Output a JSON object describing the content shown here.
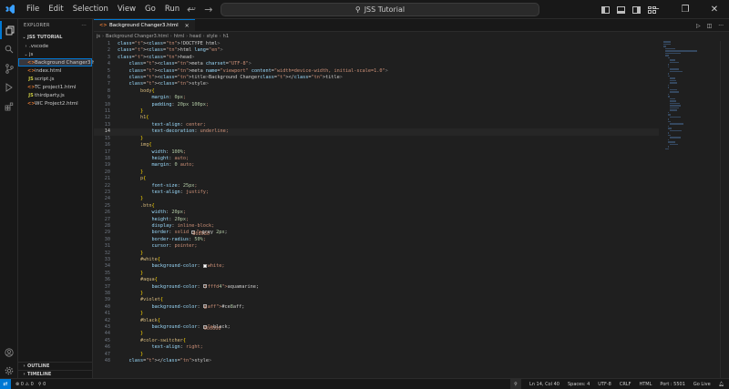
{
  "titlebar": {
    "menu": [
      "File",
      "Edit",
      "Selection",
      "View",
      "Go",
      "Run",
      "···"
    ],
    "search": "JSS Tutorial",
    "window_buttons": [
      "─",
      "❐",
      "✕"
    ]
  },
  "sidebar": {
    "title": "EXPLORER",
    "more": "···",
    "root": "JSS TUTORIAL",
    "items": [
      {
        "label": ".vscode",
        "type": "folder",
        "indent": 1,
        "expanded": false
      },
      {
        "label": "js",
        "type": "folder",
        "indent": 1,
        "expanded": true
      },
      {
        "label": "Background Changer3.html",
        "type": "html",
        "indent": 2,
        "selected": true
      },
      {
        "label": "index.html",
        "type": "html",
        "indent": 2
      },
      {
        "label": "script.js",
        "type": "js",
        "indent": 2
      },
      {
        "label": "TC project1.html",
        "type": "html",
        "indent": 2
      },
      {
        "label": "thirdparty.js",
        "type": "js",
        "indent": 2
      },
      {
        "label": "WC Project2.html",
        "type": "html",
        "indent": 2
      }
    ],
    "outline": "OUTLINE",
    "timeline": "TIMELINE"
  },
  "editor": {
    "tab": "Background Changer3.html",
    "breadcrumb": [
      "js",
      "Background Changer3.html",
      "html",
      "head",
      "style",
      "h1"
    ],
    "lines": [
      "<!DOCTYPE html>",
      "<html lang=\"en\">",
      "<head>",
      "    <meta charset=\"UTF-8\">",
      "    <meta name=\"viewport\" content=\"width=device-width, initial-scale=1.0\">",
      "    <title>Background Changer</title>",
      "    <style>",
      "        body{",
      "            margin: 0px;",
      "            padding: 20px 100px;",
      "        }",
      "        h1{",
      "            text-align: center;",
      "            text-decoration: underline;",
      "        }",
      "        img{",
      "            width: 100%;",
      "            height: auto;",
      "            margin: 0 auto;",
      "        }",
      "        p{",
      "            font-size: 25px;",
      "            text-align: justify;",
      "        }",
      "        .btn{",
      "            width: 20px;",
      "            height: 20px;",
      "            display: inline-block;",
      "            border: solid grey 2px;",
      "            border-radius: 50%;",
      "            cursor: pointer;",
      "        }",
      "        #white{",
      "            background-color: white;",
      "        }",
      "        #aqua{",
      "            background-color: aquamarine;",
      "        }",
      "        #violet{",
      "            background-color: #ce8aff;",
      "        }",
      "        #black{",
      "            background-color: black;",
      "        }",
      "        #color-switcher{",
      "            text-align: right;",
      "        }",
      "    </style>"
    ],
    "current_line": 14
  },
  "statusbar": {
    "problems": "⊗ 0 ⚠ 0",
    "ports": "⚲ 0",
    "cursor": "Ln 14, Col 40",
    "spaces": "Spaces: 4",
    "encoding": "UTF-8",
    "eol": "CRLF",
    "language": "HTML",
    "port": "Port : 5501",
    "golive": "Go Live"
  },
  "colors": {
    "accent": "#0078d4",
    "white": "#ffffff",
    "aquamarine": "#7fffd4",
    "violet": "#ce8aff",
    "black": "#000000"
  }
}
